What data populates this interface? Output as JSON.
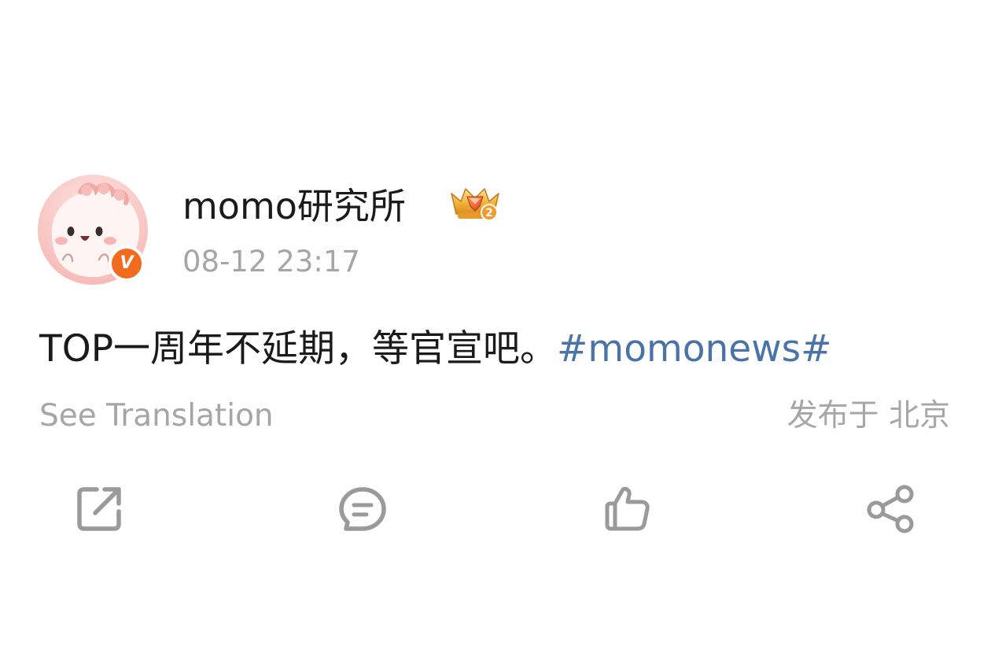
{
  "post": {
    "author": {
      "name": "momo研究所",
      "verified_mark": "V",
      "avatar_icon": "pink-blob-avatar-icon",
      "rank_badge_icon": "gold-crown-rank-2-icon",
      "rank_badge_number": "2"
    },
    "timestamp": "08-12 23:17",
    "text": "TOP一周年不延期，等官宣吧。",
    "hashtag": "#momonews#",
    "translation_link": "See Translation",
    "location": "发布于 北京"
  },
  "actions": [
    {
      "name": "repost",
      "icon": "repost-icon"
    },
    {
      "name": "comment",
      "icon": "comment-icon"
    },
    {
      "name": "like",
      "icon": "thumbs-up-icon"
    },
    {
      "name": "share",
      "icon": "share-icon"
    }
  ],
  "colors": {
    "text_primary": "#1a1a1a",
    "text_secondary": "#a6a6a6",
    "hashtag": "#4a73a8",
    "verified_badge": "#f26b1d",
    "icon": "#9a9a9a",
    "avatar_bg": "#f7c9c6"
  }
}
